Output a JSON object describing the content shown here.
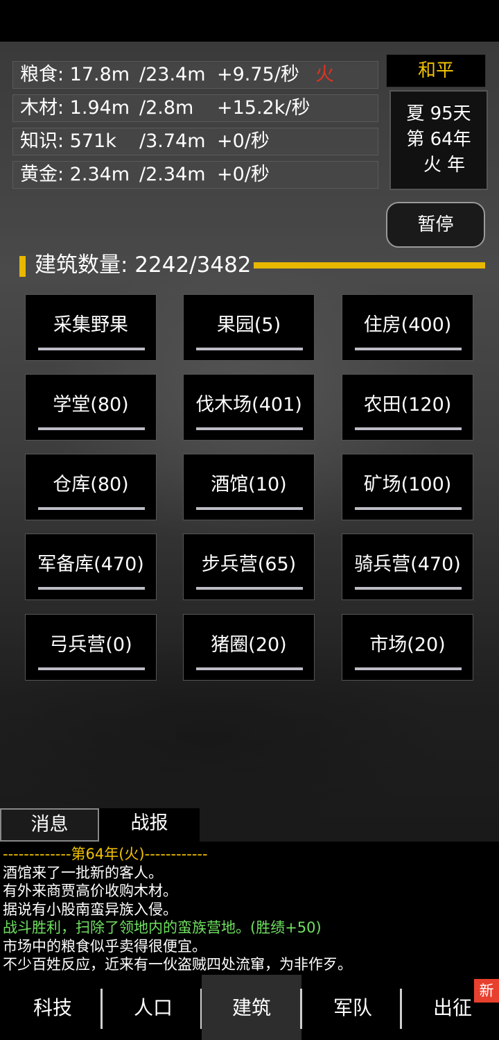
{
  "resources": [
    {
      "name": "粮食: 17.8m",
      "max": "/23.4m",
      "rate": "+9.75/秒",
      "flag": "火"
    },
    {
      "name": "木材: 1.94m",
      "max": "/2.8m",
      "rate": "+15.2k/秒",
      "flag": ""
    },
    {
      "name": "知识: 571k",
      "max": "/3.74m",
      "rate": "+0/秒",
      "flag": ""
    },
    {
      "name": "黄金: 2.34m",
      "max": "/2.34m",
      "rate": "+0/秒",
      "flag": ""
    }
  ],
  "state": "和平",
  "season": {
    "day": "夏 95天",
    "year": "第 64年",
    "element": "火 年"
  },
  "pause_label": "暂停",
  "building_count": {
    "label": "建筑数量: 2242/3482",
    "fill_fraction": 0.644
  },
  "buildings": [
    "采集野果",
    "果园(5)",
    "住房(400)",
    "学堂(80)",
    "伐木场(401)",
    "农田(120)",
    "仓库(80)",
    "酒馆(10)",
    "矿场(100)",
    "军备库(470)",
    "步兵营(65)",
    "骑兵营(470)",
    "弓兵营(0)",
    "猪圈(20)",
    "市场(20)"
  ],
  "tabs": [
    "消息",
    "战报"
  ],
  "log": [
    "-------------第64年(火)------------",
    "酒馆来了一批新的客人。",
    "有外来商贾高价收购木材。",
    "据说有小股南蛮异族入侵。",
    "战斗胜利，扫除了领地内的蛮族营地。(胜绩+50)",
    "市场中的粮食似乎卖得很便宜。",
    "不少百姓反应，近来有一伙盗贼四处流窜，为非作歹。"
  ],
  "nav": [
    "科技",
    "人口",
    "建筑",
    "军队",
    "出征"
  ],
  "nav_active": "建筑",
  "new_badge": "新",
  "colors": {
    "accent": "#e8b800",
    "fire": "#e0321e",
    "victory": "#6fe060"
  }
}
